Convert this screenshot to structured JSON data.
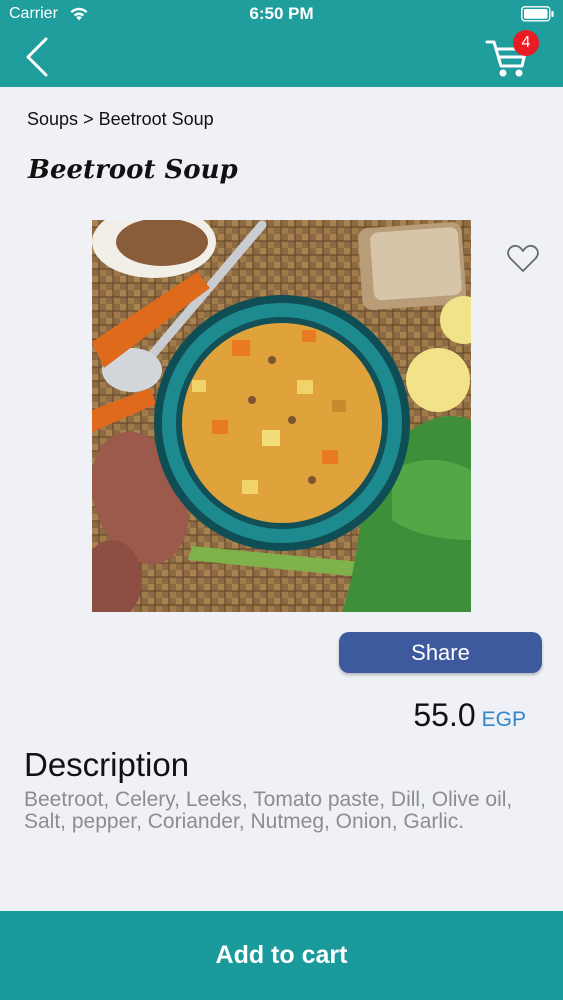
{
  "status_bar": {
    "carrier": "Carrier",
    "time": "6:50 PM"
  },
  "header": {
    "back_icon": "chevron-left-icon",
    "cart_icon": "shopping-cart-icon",
    "cart_count": "4",
    "background_color": "#1f9e9d",
    "badge_color": "#ea1b23"
  },
  "breadcrumb": {
    "category": "Soups",
    "separator": ">",
    "current": "Beetroot Soup"
  },
  "product": {
    "title": "Beetroot Soup",
    "favorite_icon": "heart-outline-icon",
    "share_label": "Share",
    "price": "55.0",
    "currency": "EGP"
  },
  "description": {
    "heading": "Description",
    "body": "Beetroot, Celery, Leeks, Tomato paste, Dill, Olive oil, Salt, pepper, Coriander, Nutmeg, Onion, Garlic."
  },
  "footer": {
    "add_to_cart_label": "Add to cart"
  },
  "colors": {
    "accent": "#1a9a9a",
    "share_button": "#3d5a9e",
    "currency": "#2f86c8",
    "page_background": "#eff1f6"
  }
}
